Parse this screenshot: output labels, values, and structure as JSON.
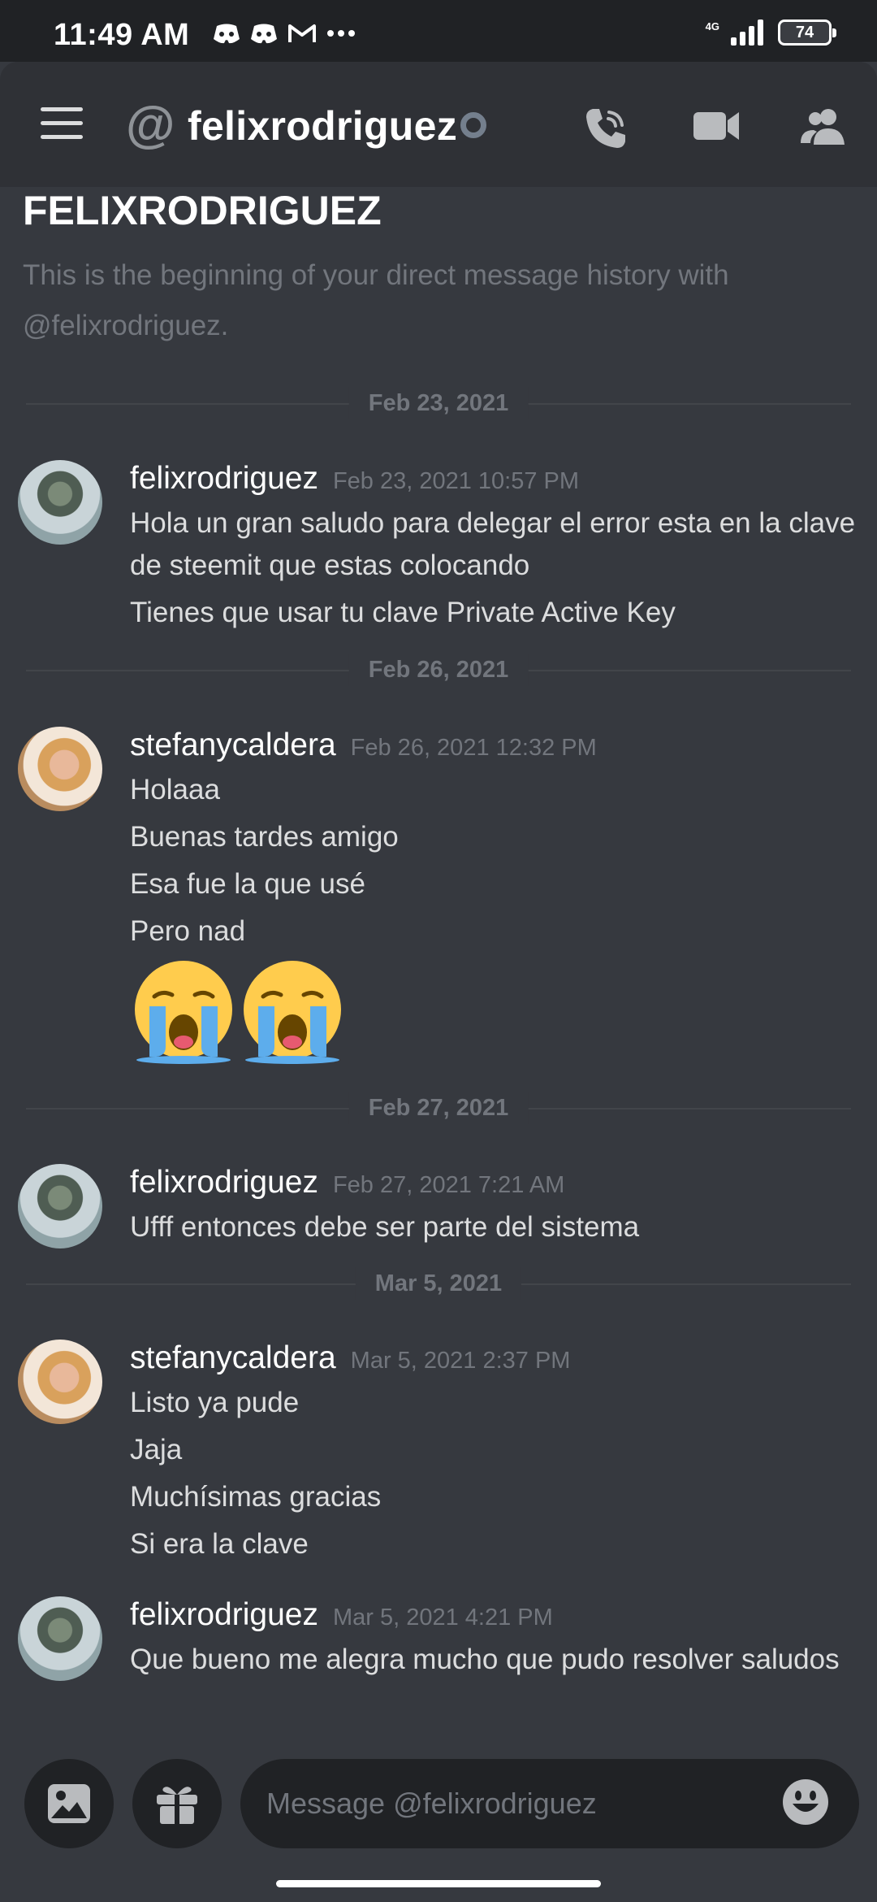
{
  "status_bar": {
    "time": "11:49 AM",
    "network": "4G",
    "battery": "74"
  },
  "header": {
    "title": "felixrodriguez"
  },
  "intro": {
    "title": "FELIXRODRIGUEZ",
    "subtitle": "This is the beginning of your direct message history with @felixrodriguez."
  },
  "groups": [
    {
      "divider": "Feb 23, 2021",
      "author": "felixrodriguez",
      "time": "Feb 23, 2021 10:57 PM",
      "lines": [
        "Hola un gran saludo para delegar el error esta en la clave de steemit que estas colocando",
        "Tienes que usar tu clave Private Active Key"
      ]
    },
    {
      "divider": "Feb 26, 2021",
      "author": "stefanycaldera",
      "time": "Feb 26, 2021 12:32 PM",
      "lines": [
        "Holaaa",
        "Buenas tardes amigo",
        "Esa fue la que usé",
        "Pero nad"
      ]
    },
    {
      "divider": "Feb 27, 2021",
      "author": "felixrodriguez",
      "time": "Feb 27, 2021 7:21 AM",
      "lines": [
        "Ufff entonces debe ser parte del sistema"
      ]
    },
    {
      "divider": "Mar 5, 2021",
      "author": "stefanycaldera",
      "time": "Mar 5, 2021 2:37 PM",
      "lines": [
        "Listo ya pude",
        "Jaja",
        "Muchísimas gracias",
        "Si era la clave"
      ]
    },
    {
      "author": "felixrodriguez",
      "time": "Mar 5, 2021 4:21 PM",
      "lines": [
        "Que bueno me alegra mucho que pudo resolver saludos"
      ]
    }
  ],
  "composer": {
    "placeholder": "Message @felixrodriguez"
  },
  "colors": {
    "background": "#36393f",
    "header": "#2f3136",
    "input": "#202225",
    "muted": "#72767d"
  },
  "icons": [
    "menu-icon",
    "at-icon",
    "call-icon",
    "video-icon",
    "members-icon",
    "image-icon",
    "gift-icon",
    "emoji-icon",
    "crying-emoji"
  ]
}
